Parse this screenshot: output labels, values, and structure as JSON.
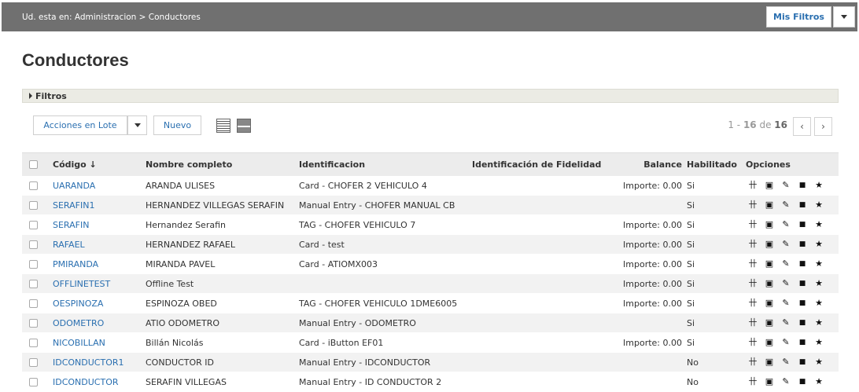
{
  "breadcrumb": "Ud. esta en: Administracion > Conductores",
  "top_actions": {
    "filters_label": "Mis Filtros"
  },
  "page": {
    "title": "Conductores"
  },
  "filters_panel": {
    "label": "Filtros"
  },
  "toolbar": {
    "batch_label": "Acciones en Lote",
    "new_label": "Nuevo"
  },
  "pagination": {
    "range_start": "1",
    "range_end": "16",
    "connector": "de",
    "total": "16",
    "prev": "‹",
    "next": "›"
  },
  "table": {
    "headers": {
      "code": "Código ↓",
      "name": "Nombre completo",
      "id": "Identificacion",
      "fidelity": "Identificación de Fidelidad",
      "balance": "Balance",
      "enabled": "Habilitado",
      "options": "Opciones"
    },
    "rows": [
      {
        "code": "UARANDA",
        "name": "ARANDA ULISES",
        "id": "Card - CHOFER 2 VEHICULO 4",
        "fidelity": "",
        "balance": "Importe: 0.00",
        "enabled": "Si"
      },
      {
        "code": "SERAFIN1",
        "name": "HERNANDEZ VILLEGAS SERAFIN",
        "id": "Manual Entry - CHOFER MANUAL CB",
        "fidelity": "",
        "balance": "",
        "enabled": "Si"
      },
      {
        "code": "SERAFIN",
        "name": "Hernandez Serafin",
        "id": "TAG - CHOFER VEHICULO 7",
        "fidelity": "",
        "balance": "Importe: 0.00",
        "enabled": "Si"
      },
      {
        "code": "RAFAEL",
        "name": "HERNANDEZ RAFAEL",
        "id": "Card - test",
        "fidelity": "",
        "balance": "Importe: 0.00",
        "enabled": "Si"
      },
      {
        "code": "PMIRANDA",
        "name": "MIRANDA PAVEL",
        "id": "Card - ATIOMX003",
        "fidelity": "",
        "balance": "Importe: 0.00",
        "enabled": "Si"
      },
      {
        "code": "OFFLINETEST",
        "name": "Offline Test",
        "id": "",
        "fidelity": "",
        "balance": "Importe: 0.00",
        "enabled": "Si"
      },
      {
        "code": "OESPINOZA",
        "name": "ESPINOZA OBED",
        "id": "TAG - CHOFER VEHICULO 1DME6005",
        "fidelity": "",
        "balance": "Importe: 0.00",
        "enabled": "Si"
      },
      {
        "code": "ODOMETRO",
        "name": "ATIO ODOMETRO",
        "id": "Manual Entry - ODOMETRO",
        "fidelity": "",
        "balance": "",
        "enabled": "Si"
      },
      {
        "code": "NICOBILLAN",
        "name": "Billán Nicolás",
        "id": "Card - iButton EF01",
        "fidelity": "",
        "balance": "Importe: 0.00",
        "enabled": "Si"
      },
      {
        "code": "IDCONDUCTOR1",
        "name": "CONDUCTOR ID",
        "id": "Manual Entry - IDCONDUCTOR",
        "fidelity": "",
        "balance": "",
        "enabled": "No"
      },
      {
        "code": "IDCONDUCTOR",
        "name": "SERAFIN VILLEGAS",
        "id": "Manual Entry - ID CONDUCTOR 2",
        "fidelity": "",
        "balance": "",
        "enabled": "No"
      }
    ]
  },
  "row_option_icons": [
    "branch-icon",
    "card-icon",
    "edit-icon",
    "lock-icon",
    "star-icon"
  ],
  "colors": {
    "topbar": "#707070",
    "link": "#2a6fb0",
    "header_row": "#ececec",
    "alt_row": "#f2f2f2"
  }
}
